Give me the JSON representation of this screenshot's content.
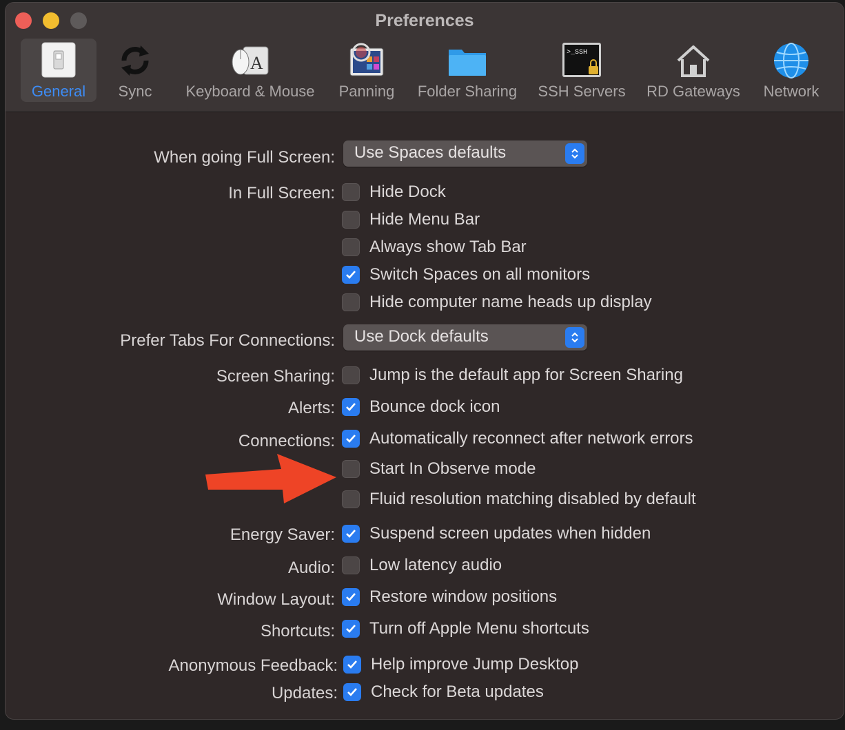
{
  "window": {
    "title": "Preferences"
  },
  "toolbar": {
    "items": [
      {
        "label": "General",
        "icon": "switch-icon",
        "selected": true
      },
      {
        "label": "Sync",
        "icon": "sync-icon"
      },
      {
        "label": "Keyboard & Mouse",
        "icon": "keyboard-mouse-icon"
      },
      {
        "label": "Panning",
        "icon": "panning-icon"
      },
      {
        "label": "Folder Sharing",
        "icon": "folder-icon"
      },
      {
        "label": "SSH Servers",
        "icon": "terminal-lock-icon"
      },
      {
        "label": "RD Gateways",
        "icon": "house-icon"
      },
      {
        "label": "Network",
        "icon": "globe-icon"
      }
    ]
  },
  "form": {
    "full_screen_label": "When going Full Screen:",
    "full_screen_value": "Use Spaces defaults",
    "in_full_screen_label": "In Full Screen:",
    "in_full_screen_options": [
      {
        "label": "Hide Dock",
        "checked": false
      },
      {
        "label": "Hide Menu Bar",
        "checked": false
      },
      {
        "label": "Always show Tab Bar",
        "checked": false
      },
      {
        "label": "Switch Spaces on all monitors",
        "checked": true
      },
      {
        "label": "Hide computer name heads up display",
        "checked": false
      }
    ],
    "prefer_tabs_label": "Prefer Tabs For Connections:",
    "prefer_tabs_value": "Use Dock defaults",
    "screen_sharing_label": "Screen Sharing:",
    "screen_sharing_option": {
      "label": "Jump is the default app for Screen Sharing",
      "checked": false
    },
    "alerts_label": "Alerts:",
    "alerts_option": {
      "label": "Bounce dock icon",
      "checked": true
    },
    "connections_label": "Connections:",
    "connections_options": [
      {
        "label": "Automatically reconnect after network errors",
        "checked": true
      },
      {
        "label": "Start In Observe mode",
        "checked": false
      },
      {
        "label": "Fluid resolution matching disabled by default",
        "checked": false
      }
    ],
    "energy_label": "Energy Saver:",
    "energy_option": {
      "label": "Suspend screen updates when hidden",
      "checked": true
    },
    "audio_label": "Audio:",
    "audio_option": {
      "label": "Low latency audio",
      "checked": false
    },
    "window_layout_label": "Window Layout:",
    "window_layout_option": {
      "label": "Restore window positions",
      "checked": true
    },
    "shortcuts_label": "Shortcuts:",
    "shortcuts_option": {
      "label": "Turn off Apple Menu shortcuts",
      "checked": true
    },
    "feedback_label": "Anonymous Feedback:",
    "feedback_option": {
      "label": "Help improve Jump Desktop",
      "checked": true
    },
    "updates_label": "Updates:",
    "updates_option": {
      "label": "Check for Beta updates",
      "checked": true
    }
  },
  "colors": {
    "accent": "#2a7cf0",
    "annotation_arrow": "#ee4426",
    "window_bg": "#2f2828",
    "toolbar_bg": "#3b3535"
  }
}
